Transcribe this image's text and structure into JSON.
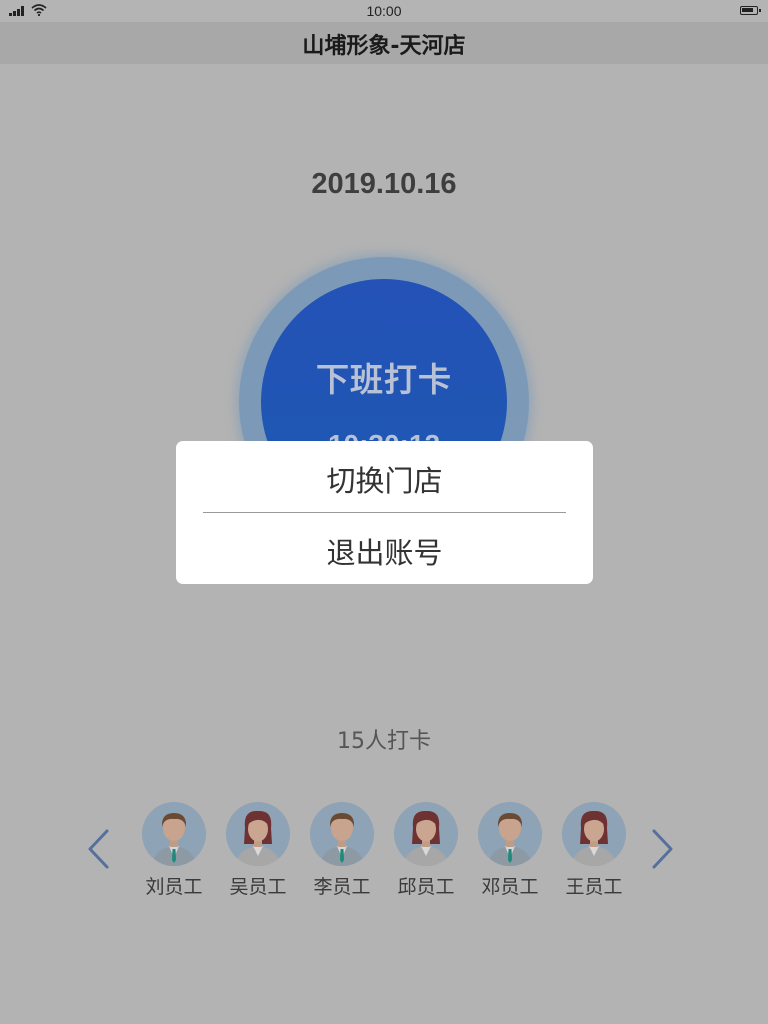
{
  "status_bar": {
    "time": "10:00"
  },
  "nav": {
    "title": "山埔形象-天河店"
  },
  "date": "2019.10.16",
  "clock_button": {
    "label": "下班打卡",
    "time": "10:30:12"
  },
  "popup": {
    "items": [
      "切换门店",
      "退出账号"
    ]
  },
  "checkin_count": "15人打卡",
  "employees": [
    {
      "name": "刘员工",
      "gender": "male"
    },
    {
      "name": "吴员工",
      "gender": "female"
    },
    {
      "name": "李员工",
      "gender": "male"
    },
    {
      "name": "邱员工",
      "gender": "female"
    },
    {
      "name": "邓员工",
      "gender": "male"
    },
    {
      "name": "王员工",
      "gender": "female"
    }
  ],
  "colors": {
    "overlay": "#b3b3b3",
    "clock_ring": "#7c9ab8",
    "clock_fill": "#2452b6",
    "arrow": "#56709e",
    "popup_bg": "#ffffff"
  }
}
